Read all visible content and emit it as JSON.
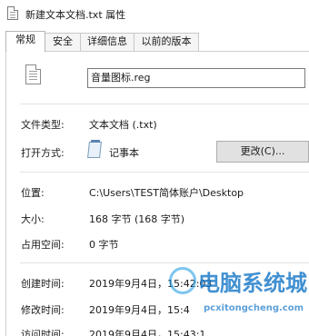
{
  "window": {
    "title": "新建文本文档.txt 属性",
    "icon": "document-icon"
  },
  "tabs": [
    {
      "label": "常规",
      "active": true
    },
    {
      "label": "安全",
      "active": false
    },
    {
      "label": "详细信息",
      "active": false
    },
    {
      "label": "以前的版本",
      "active": false
    }
  ],
  "file": {
    "icon": "text-file-icon",
    "name": "音量图标.reg"
  },
  "fields": {
    "type_label": "文件类型:",
    "type_value": "文本文档 (.txt)",
    "open_label": "打开方式:",
    "open_value": "记事本",
    "open_icon": "notepad-icon",
    "change_button": "更改(C)...",
    "location_label": "位置:",
    "location_value": "C:\\Users\\TEST简体账户\\Desktop",
    "size_label": "大小:",
    "size_value": "168 字节 (168 字节)",
    "disk_label": "占用空间:",
    "disk_value": "0 字节",
    "created_label": "创建时间:",
    "created_value": "2019年9月4日，15:42:03",
    "modified_label": "修改时间:",
    "modified_value": "2019年9月4日，15:4",
    "accessed_label": "访问时间:",
    "accessed_value": "2019年9月4日，15:43:1"
  },
  "watermark": {
    "text": "电脑系统城",
    "url": "pcxitongcheng.com"
  }
}
